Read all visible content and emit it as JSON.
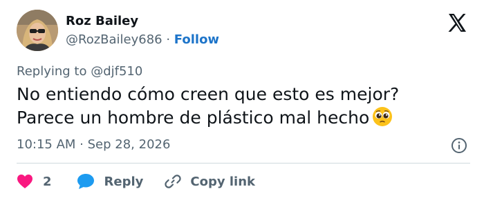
{
  "tweet": {
    "author_name": "Roz Bailey",
    "handle": "@RozBailey686",
    "separator": " · ",
    "follow_label": "Follow",
    "replying_prefix": "Replying to ",
    "replying_handle": "@djf510",
    "text_line1": "No entiendo cómo creen que esto es mejor?",
    "text_line2": "Parece un hombre de plástico mal hecho",
    "emoji": "pleading-face",
    "time": "10:15 AM",
    "date_separator": " · ",
    "date": "Sep 28, 2026"
  },
  "actions": {
    "like_count": "2",
    "reply_label": "Reply",
    "copy_label": "Copy link"
  },
  "colors": {
    "follow": "#1d74c9",
    "like_heart": "#f91880",
    "reply_bubble": "#1d9bf0",
    "secondary_text": "#536471",
    "divider": "#cfd9de"
  },
  "icons": [
    "x-logo-icon",
    "info-icon",
    "heart-icon",
    "reply-bubble-icon",
    "link-icon"
  ]
}
